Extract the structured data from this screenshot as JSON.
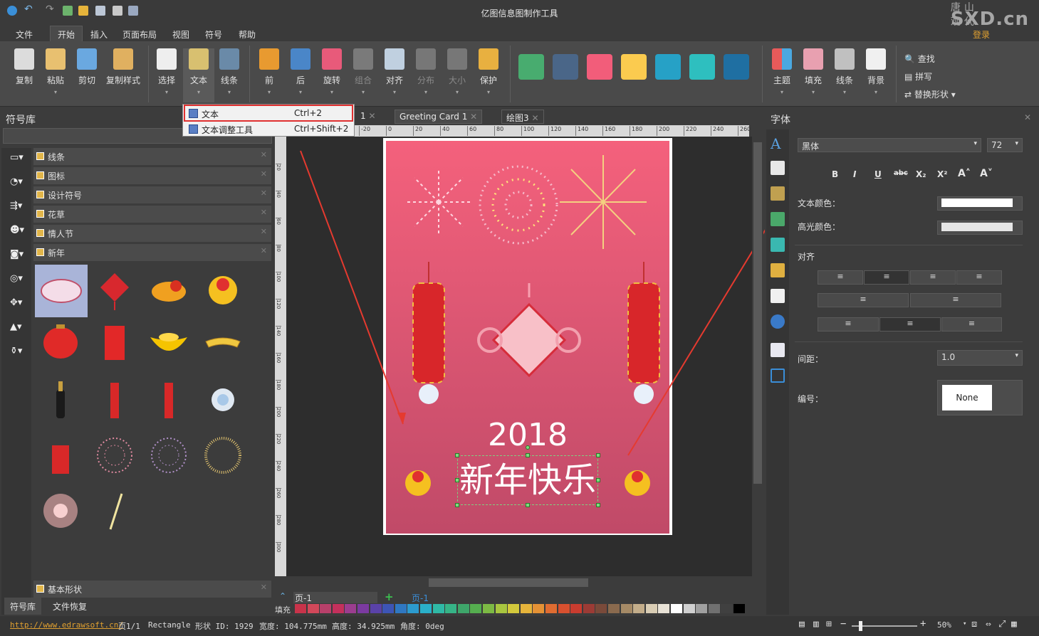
{
  "app": {
    "title": "亿图信息图制作工具",
    "watermark_top": "唐山观代",
    "watermark_bottom": "SXD.cn",
    "login": "登录"
  },
  "menu": [
    "文件",
    "开始",
    "插入",
    "页面布局",
    "视图",
    "符号",
    "帮助"
  ],
  "ribbon": {
    "clipboard": [
      "复制",
      "粘贴",
      "剪切",
      "复制样式"
    ],
    "tools": [
      "选择",
      "文本",
      "线条"
    ],
    "arrange": [
      "前",
      "后",
      "旋转",
      "组合",
      "对齐",
      "分布",
      "大小",
      "保护"
    ],
    "style_swatches": [
      "#48ac6f",
      "#4a6688",
      "#f25d7a",
      "#fbcb4f",
      "#26a1c6",
      "#2ebfbf",
      "#1f6fa2"
    ],
    "style": [
      "主题",
      "填充",
      "线条",
      "背景"
    ],
    "find": [
      "查找",
      "拼写",
      "替换形状"
    ]
  },
  "dropdown": {
    "items": [
      {
        "label": "文本",
        "shortcut": "Ctrl+2"
      },
      {
        "label": "文本调整工具",
        "shortcut": "Ctrl+Shift+2"
      }
    ]
  },
  "library": {
    "title": "符号库",
    "categories": [
      "线条",
      "图标",
      "设计符号",
      "花草",
      "情人节",
      "新年"
    ],
    "footer_category": "基本形状",
    "tabs": [
      "符号库",
      "文件恢复"
    ]
  },
  "docs": {
    "tabs": [
      "1",
      "Greeting Card 1",
      "绘图3"
    ]
  },
  "ruler": {
    "top": [
      "-20",
      "0",
      "20",
      "40",
      "60",
      "80",
      "100",
      "120",
      "140",
      "160",
      "180",
      "200",
      "220",
      "240",
      "260"
    ],
    "left": [
      "20",
      "40",
      "60",
      "80",
      "100",
      "120",
      "140",
      "160",
      "180",
      "200",
      "220",
      "240",
      "260",
      "280",
      "300"
    ]
  },
  "card": {
    "year": "2018",
    "greeting": "新年快乐"
  },
  "pagebar": {
    "page": "页-1",
    "page_tab": "页-1",
    "fill_label": "填充"
  },
  "font_panel": {
    "title": "字体",
    "font": "黑体",
    "size": "72",
    "format": [
      "B",
      "I",
      "U",
      "abc",
      "X₂",
      "X²",
      "A˄",
      "A˅"
    ],
    "text_color_label": "文本颜色：",
    "highlight_label": "高光颜色：",
    "align_label": "对齐",
    "spacing_label": "间距：",
    "spacing_value": "1.0",
    "numbering_label": "编号：",
    "numbering_value": "None"
  },
  "status": {
    "link": "http://www.edrawsoft.cn/",
    "page": "页1/1",
    "shape": "Rectangle",
    "shape_id": "形状 ID: 1929",
    "width": "宽度: 104.775mm",
    "height": "高度: 34.925mm",
    "angle": "角度: 0deg",
    "zoom": "50%"
  },
  "palette": [
    "#c8334a",
    "#d2485a",
    "#b8406a",
    "#c4305c",
    "#9b3d8f",
    "#7b3aa0",
    "#5a42a8",
    "#3d55b5",
    "#2f78c2",
    "#2c9bcf",
    "#2ab0c9",
    "#2fb9a6",
    "#36b487",
    "#3ea66a",
    "#55ae4f",
    "#7dba44",
    "#a9c63f",
    "#d3c93c",
    "#e6b43b",
    "#e59235",
    "#e06c31",
    "#d8502f",
    "#c93c2f",
    "#9c3b35",
    "#7a4a3a",
    "#8a6a4e",
    "#a58a66",
    "#c3ad8a",
    "#d9cdb4",
    "#e8e2d6",
    "#ffffff",
    "#d0d0d0",
    "#a0a0a0",
    "#707070",
    "#404040",
    "#000000"
  ]
}
